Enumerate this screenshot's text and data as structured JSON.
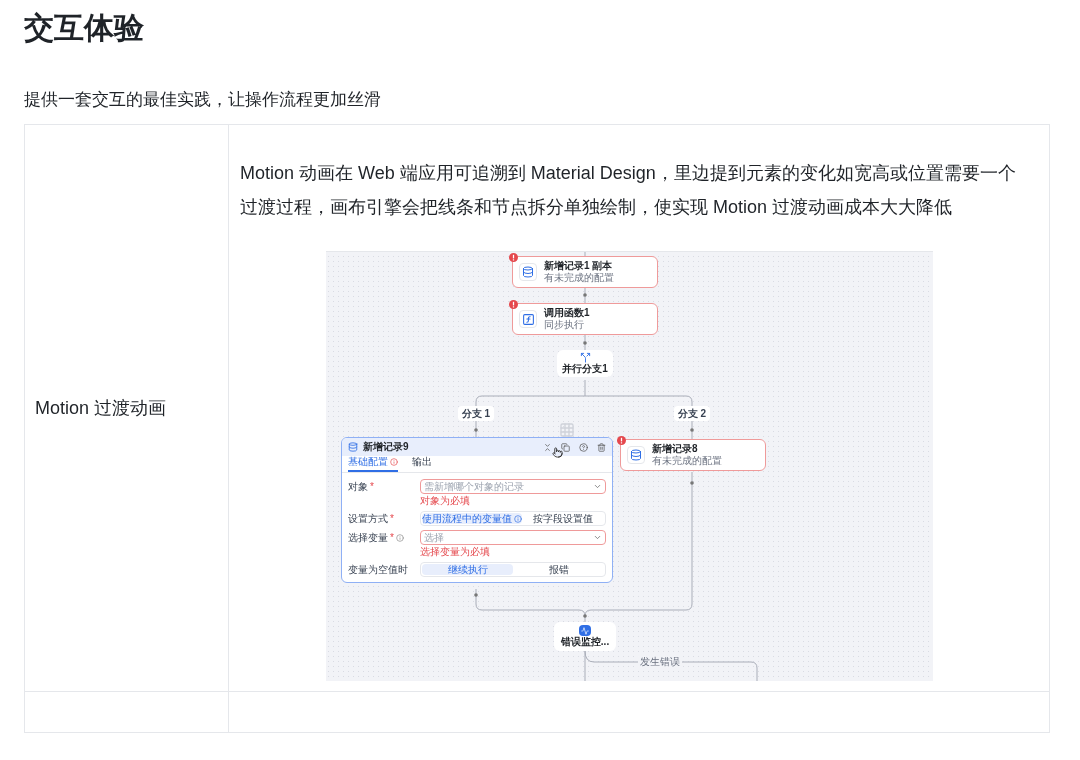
{
  "heading": "交互体验",
  "intro": "提供一套交互的最佳实践，让操作流程更加丝滑",
  "table": {
    "rows": [
      {
        "feature": "Motion 过渡动画",
        "description": "Motion 动画在 Web 端应用可追溯到 Material Design，里边提到元素的变化如宽高或位置需要一个过渡过程，画布引擎会把线条和节点拆分单独绘制，使实现 Motion 过渡动画成本大大降低",
        "screenshot": {
          "nodes": [
            {
              "kind": "record",
              "title": "新增记录1 副本",
              "subtitle": "有未完成的配置",
              "error": true
            },
            {
              "kind": "function",
              "title": "调用函数1",
              "subtitle": "同步执行",
              "error": true
            },
            {
              "kind": "branch",
              "title": "并行分支1"
            }
          ],
          "branches": [
            {
              "label": "分支 1"
            },
            {
              "label": "分支 2"
            }
          ],
          "config_panel": {
            "title": "新增记录9",
            "tabs": [
              {
                "label": "基础配置",
                "selected": true,
                "warning": true
              },
              {
                "label": "输出",
                "selected": false,
                "warning": false
              }
            ],
            "fields": [
              {
                "kind": "select",
                "label": "对象",
                "mark": "*",
                "info": false,
                "placeholder": "需新增哪个对象的记录",
                "error": "对象为必填"
              },
              {
                "kind": "segmented",
                "label": "设置方式",
                "mark": "*",
                "info": false,
                "options": [
                  {
                    "label": "使用流程中的变量值",
                    "selected": true,
                    "info": true
                  },
                  {
                    "label": "按字段设置值",
                    "selected": false,
                    "info": false
                  }
                ]
              },
              {
                "kind": "select",
                "label": "选择变量",
                "mark": "*",
                "info": true,
                "placeholder": "选择",
                "error": "选择变量为必填"
              },
              {
                "kind": "segmented",
                "label": "变量为空值时",
                "info": false,
                "options": [
                  {
                    "label": "继续执行",
                    "selected": true,
                    "info": false
                  },
                  {
                    "label": "报错",
                    "selected": false,
                    "info": false
                  }
                ]
              }
            ]
          },
          "side_node": {
            "kind": "record",
            "title": "新增记录8",
            "subtitle": "有未完成的配置",
            "error": true
          },
          "monitor_node": {
            "title": "错误监控..."
          },
          "edge_label": "发生错误"
        }
      }
    ]
  }
}
